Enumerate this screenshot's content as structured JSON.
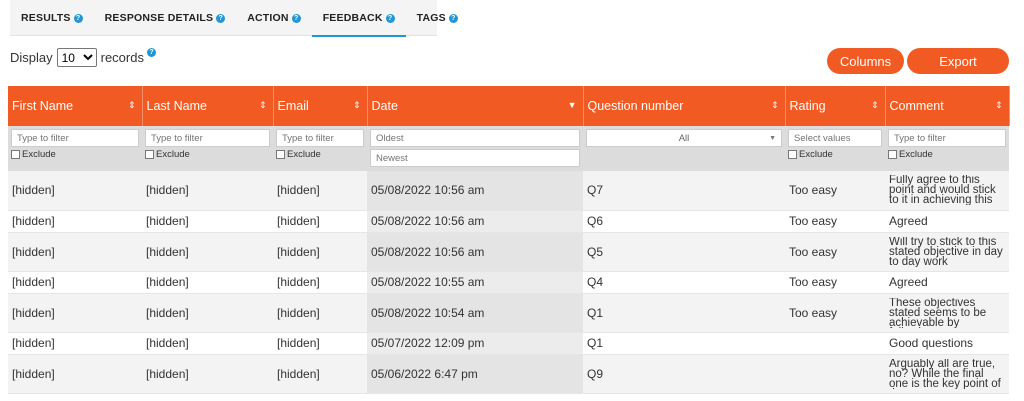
{
  "tabs": [
    {
      "label": "RESULTS",
      "help": "?"
    },
    {
      "label": "RESPONSE DETAILS",
      "help": "?"
    },
    {
      "label": "ACTION",
      "help": "?"
    },
    {
      "label": "FEEDBACK",
      "help": "?",
      "active": true
    },
    {
      "label": "TAGS",
      "help": "?"
    }
  ],
  "display": {
    "prefix": "Display",
    "value": "10",
    "suffix": "records",
    "help": "?"
  },
  "buttons": {
    "columns": "Columns",
    "export": "Export"
  },
  "colors": {
    "accent": "#f15a22",
    "help": "#2196d3"
  },
  "table": {
    "headers": [
      "First Name",
      "Last Name",
      "Email",
      "Date",
      "Question number",
      "Rating",
      "Comment"
    ],
    "filters": {
      "text_placeholder": "Type to filter",
      "exclude": "Exclude",
      "date_from": "Oldest",
      "date_to": "Newest",
      "question_select": "All",
      "rating_placeholder": "Select values"
    },
    "rows": [
      {
        "first": "[hidden]",
        "last": "[hidden]",
        "email": "[hidden]",
        "date": "05/08/2022 10:56 am",
        "question": "Q7",
        "rating": "Too easy",
        "comment": "Fully agree to this point and would stick to it in achieving this"
      },
      {
        "first": "[hidden]",
        "last": "[hidden]",
        "email": "[hidden]",
        "date": "05/08/2022 10:56 am",
        "question": "Q6",
        "rating": "Too easy",
        "comment": "Agreed"
      },
      {
        "first": "[hidden]",
        "last": "[hidden]",
        "email": "[hidden]",
        "date": "05/08/2022 10:56 am",
        "question": "Q5",
        "rating": "Too easy",
        "comment": "Will try to stick to this stated objective in day to day work"
      },
      {
        "first": "[hidden]",
        "last": "[hidden]",
        "email": "[hidden]",
        "date": "05/08/2022 10:55 am",
        "question": "Q4",
        "rating": "Too easy",
        "comment": "Agreed"
      },
      {
        "first": "[hidden]",
        "last": "[hidden]",
        "email": "[hidden]",
        "date": "05/08/2022 10:54 am",
        "question": "Q1",
        "rating": "Too easy",
        "comment": "These objectives stated seems to be achievable by following"
      },
      {
        "first": "[hidden]",
        "last": "[hidden]",
        "email": "[hidden]",
        "date": "05/07/2022 12:09 pm",
        "question": "Q1",
        "rating": "",
        "comment": "Good questions"
      },
      {
        "first": "[hidden]",
        "last": "[hidden]",
        "email": "[hidden]",
        "date": "05/06/2022 6:47 pm",
        "question": "Q9",
        "rating": "",
        "comment": "Arguably all are true, no? While the final one is the key point of the"
      }
    ]
  }
}
